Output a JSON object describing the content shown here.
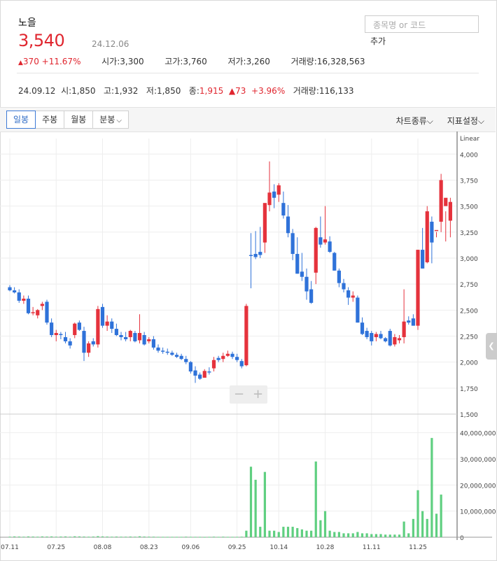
{
  "stock": {
    "name": "노을",
    "price": "3,540",
    "date": "24.12.06",
    "change_arrow": "▲",
    "change": "370",
    "change_pct": "+11.67%",
    "open_label": "시가",
    "open": "3,300",
    "high_label": "고가",
    "high": "3,760",
    "low_label": "저가",
    "low": "3,260",
    "volume_label": "거래량",
    "volume": "16,328,563"
  },
  "search": {
    "placeholder": "종목명 or 코드",
    "add_label": "추가"
  },
  "hover": {
    "date": "24.09.12",
    "open_label": "시",
    "open": "1,850",
    "high_label": "고",
    "high": "1,932",
    "low_label": "저",
    "low": "1,850",
    "close_label": "종",
    "close": "1,915",
    "change_arrow": "▲",
    "change": "73",
    "change_pct": "+3.96%",
    "volume_label": "거래량",
    "volume": "116,133"
  },
  "toolbar": {
    "tabs": [
      "일봉",
      "주봉",
      "월봉",
      "분봉"
    ],
    "minute_chevron": "⌵",
    "chart_type": "차트종류⌵",
    "indicator": "지표설정⌵"
  },
  "zoom": {
    "minus": "−",
    "plus": "+"
  },
  "chart_data": {
    "type": "candlestick",
    "scale_label": "Linear",
    "price_ticks": [
      1500,
      1750,
      2000,
      2250,
      2500,
      2750,
      3000,
      3250,
      3500,
      3750,
      4000
    ],
    "price_tick_labels": [
      "1,500",
      "1,750",
      "2,000",
      "2,250",
      "2,500",
      "2,750",
      "3,000",
      "3,250",
      "3,500",
      "3,750",
      "4,000"
    ],
    "price_range": [
      1500,
      4150
    ],
    "volume_ticks": [
      0,
      10000000,
      20000000,
      30000000,
      40000000
    ],
    "volume_tick_labels": [
      "0",
      "10,000,000",
      "20,000,000",
      "30,000,000",
      "40,000,000"
    ],
    "volume_range": [
      0,
      45000000
    ],
    "x_labels": [
      {
        "i": 0,
        "text": "07.11"
      },
      {
        "i": 10,
        "text": "07.25"
      },
      {
        "i": 20,
        "text": "08.08"
      },
      {
        "i": 30,
        "text": "08.23"
      },
      {
        "i": 39,
        "text": "09.06"
      },
      {
        "i": 49,
        "text": "09.25"
      },
      {
        "i": 58,
        "text": "10.14"
      },
      {
        "i": 68,
        "text": "10.28"
      },
      {
        "i": 78,
        "text": "11.11"
      },
      {
        "i": 88,
        "text": "11.25"
      }
    ],
    "colors": {
      "up": "#e5323c",
      "down": "#2f72d9",
      "volume": "#5fcf80",
      "grid": "#eeeeee"
    },
    "candles": [
      [
        2720,
        2740,
        2680,
        2690
      ],
      [
        2690,
        2720,
        2660,
        2670
      ],
      [
        2670,
        2700,
        2570,
        2590
      ],
      [
        2590,
        2640,
        2560,
        2610
      ],
      [
        2610,
        2640,
        2460,
        2470
      ],
      [
        2470,
        2530,
        2450,
        2480
      ],
      [
        2450,
        2510,
        2420,
        2500
      ],
      [
        2540,
        2580,
        2500,
        2560
      ],
      [
        2580,
        2600,
        2360,
        2380
      ],
      [
        2380,
        2420,
        2240,
        2260
      ],
      [
        2260,
        2310,
        2200,
        2280
      ],
      [
        2270,
        2290,
        2220,
        2260
      ],
      [
        2240,
        2290,
        2180,
        2200
      ],
      [
        2200,
        2230,
        2130,
        2160
      ],
      [
        2260,
        2380,
        2230,
        2370
      ],
      [
        2380,
        2400,
        2300,
        2310
      ],
      [
        2300,
        2340,
        2010,
        2090
      ],
      [
        2090,
        2200,
        2050,
        2180
      ],
      [
        2200,
        2230,
        2150,
        2170
      ],
      [
        2170,
        2540,
        2140,
        2510
      ],
      [
        2530,
        2560,
        2330,
        2350
      ],
      [
        2350,
        2450,
        2300,
        2390
      ],
      [
        2390,
        2420,
        2280,
        2320
      ],
      [
        2320,
        2370,
        2250,
        2260
      ],
      [
        2260,
        2290,
        2210,
        2240
      ],
      [
        2240,
        2290,
        2200,
        2220
      ],
      [
        2240,
        2310,
        2200,
        2300
      ],
      [
        2280,
        2300,
        2190,
        2200
      ],
      [
        2210,
        2460,
        2180,
        2280
      ],
      [
        2260,
        2290,
        2160,
        2170
      ],
      [
        2200,
        2240,
        2180,
        2220
      ],
      [
        2220,
        2250,
        2120,
        2140
      ],
      [
        2140,
        2170,
        2090,
        2110
      ],
      [
        2110,
        2140,
        2080,
        2100
      ],
      [
        2100,
        2130,
        2070,
        2090
      ],
      [
        2090,
        2110,
        2060,
        2070
      ],
      [
        2070,
        2090,
        2040,
        2050
      ],
      [
        2060,
        2080,
        2020,
        2030
      ],
      [
        2030,
        2060,
        1980,
        2000
      ],
      [
        2000,
        2010,
        1890,
        1910
      ],
      [
        1920,
        1960,
        1800,
        1870
      ],
      [
        1880,
        1900,
        1830,
        1840
      ],
      [
        1850,
        1932,
        1850,
        1915
      ],
      [
        1910,
        1950,
        1880,
        1900
      ],
      [
        1940,
        2050,
        1910,
        2020
      ],
      [
        2040,
        2060,
        2000,
        2020
      ],
      [
        2030,
        2090,
        2000,
        2060
      ],
      [
        2060,
        2110,
        2050,
        2080
      ],
      [
        2080,
        2100,
        2030,
        2050
      ],
      [
        2050,
        2080,
        2000,
        2020
      ],
      [
        2010,
        2030,
        1940,
        1960
      ],
      [
        1970,
        2560,
        1960,
        2540
      ],
      [
        3030,
        3240,
        2710,
        3020
      ],
      [
        3040,
        3260,
        2990,
        3010
      ],
      [
        3060,
        3300,
        3000,
        3030
      ],
      [
        3150,
        3460,
        3050,
        3530
      ],
      [
        3510,
        3930,
        3450,
        3630
      ],
      [
        3640,
        3710,
        3480,
        3580
      ],
      [
        3610,
        3720,
        3540,
        3700
      ],
      [
        3530,
        3640,
        3380,
        3410
      ],
      [
        3400,
        3510,
        3200,
        3240
      ],
      [
        3240,
        3280,
        2980,
        3040
      ],
      [
        3040,
        3200,
        2850,
        2850
      ],
      [
        2870,
        3050,
        2780,
        2820
      ],
      [
        2820,
        2900,
        2600,
        2680
      ],
      [
        2700,
        2780,
        2560,
        2570
      ],
      [
        2860,
        3300,
        2750,
        3290
      ],
      [
        3200,
        3400,
        3100,
        3130
      ],
      [
        3150,
        3500,
        3130,
        3180
      ],
      [
        3160,
        3210,
        3050,
        3060
      ],
      [
        3050,
        3060,
        2880,
        2880
      ],
      [
        2880,
        2900,
        2720,
        2760
      ],
      [
        2760,
        2800,
        2670,
        2700
      ],
      [
        2690,
        2720,
        2550,
        2620
      ],
      [
        2620,
        2680,
        2580,
        2640
      ],
      [
        2620,
        2640,
        2380,
        2380
      ],
      [
        2380,
        2430,
        2260,
        2270
      ],
      [
        2300,
        2330,
        2220,
        2240
      ],
      [
        2280,
        2300,
        2160,
        2200
      ],
      [
        2240,
        2290,
        2200,
        2270
      ],
      [
        2270,
        2300,
        2220,
        2230
      ],
      [
        2230,
        2240,
        2190,
        2200
      ],
      [
        2300,
        2320,
        2150,
        2160
      ],
      [
        2170,
        2270,
        2150,
        2240
      ],
      [
        2210,
        2260,
        2180,
        2230
      ],
      [
        2240,
        2700,
        2180,
        2390
      ],
      [
        2400,
        2440,
        2360,
        2380
      ],
      [
        2420,
        2460,
        2350,
        2350
      ],
      [
        2350,
        3080,
        2310,
        3080
      ],
      [
        3080,
        3290,
        2900,
        2900
      ],
      [
        2960,
        3500,
        2950,
        3450
      ],
      [
        3350,
        3400,
        2950,
        3150
      ],
      [
        3260,
        3250,
        3200,
        3270
      ],
      [
        3350,
        3810,
        3250,
        3750
      ],
      [
        3500,
        3450,
        3160,
        3580
      ],
      [
        3360,
        3580,
        3200,
        3540
      ]
    ],
    "volumes": [
      200000,
      300000,
      250000,
      200000,
      300000,
      250000,
      200000,
      300000,
      250000,
      300000,
      200000,
      250000,
      300000,
      200000,
      350000,
      300000,
      250000,
      200000,
      250000,
      400000,
      300000,
      250000,
      200000,
      250000,
      200000,
      200000,
      250000,
      200000,
      350000,
      250000,
      200000,
      200000,
      150000,
      150000,
      150000,
      150000,
      150000,
      150000,
      200000,
      150000,
      150000,
      150000,
      116133,
      150000,
      200000,
      150000,
      200000,
      150000,
      150000,
      150000,
      200000,
      2500000,
      27000000,
      22000000,
      4000000,
      25000000,
      2500000,
      2500000,
      2000000,
      4000000,
      4000000,
      4000000,
      3500000,
      3000000,
      2500000,
      2500000,
      29000000,
      6500000,
      10000000,
      2500000,
      2000000,
      2000000,
      1500000,
      1500000,
      1500000,
      2000000,
      1500000,
      1500000,
      1200000,
      1200000,
      1200000,
      1000000,
      1000000,
      1000000,
      1000000,
      6000000,
      1500000,
      7000000,
      18000000,
      10000000,
      7000000,
      38000000,
      9000000,
      16328563
    ]
  }
}
